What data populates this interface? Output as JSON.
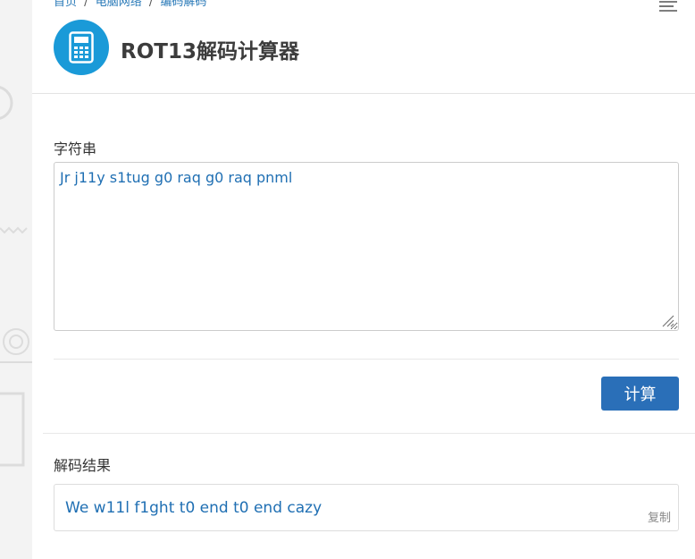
{
  "breadcrumb": {
    "items": [
      "首页",
      "电脑网络",
      "编码解码"
    ],
    "separator": "/"
  },
  "header": {
    "title": "ROT13解码计算器",
    "logo_icon": "calculator-icon",
    "menu_icon": "menu-icon"
  },
  "input": {
    "label": "字符串",
    "value": "Jr j11y s1tug g0 raq g0 raq pnml"
  },
  "actions": {
    "calculate_label": "计算"
  },
  "result": {
    "label": "解码结果",
    "value": "We w11l f1ght t0 end t0 end cazy",
    "copy_label": "复制"
  },
  "colors": {
    "accent": "#2a6fb8",
    "logo_bg": "#1a9ad8",
    "link": "#2a7ab8",
    "value_text": "#1f6fb3"
  }
}
